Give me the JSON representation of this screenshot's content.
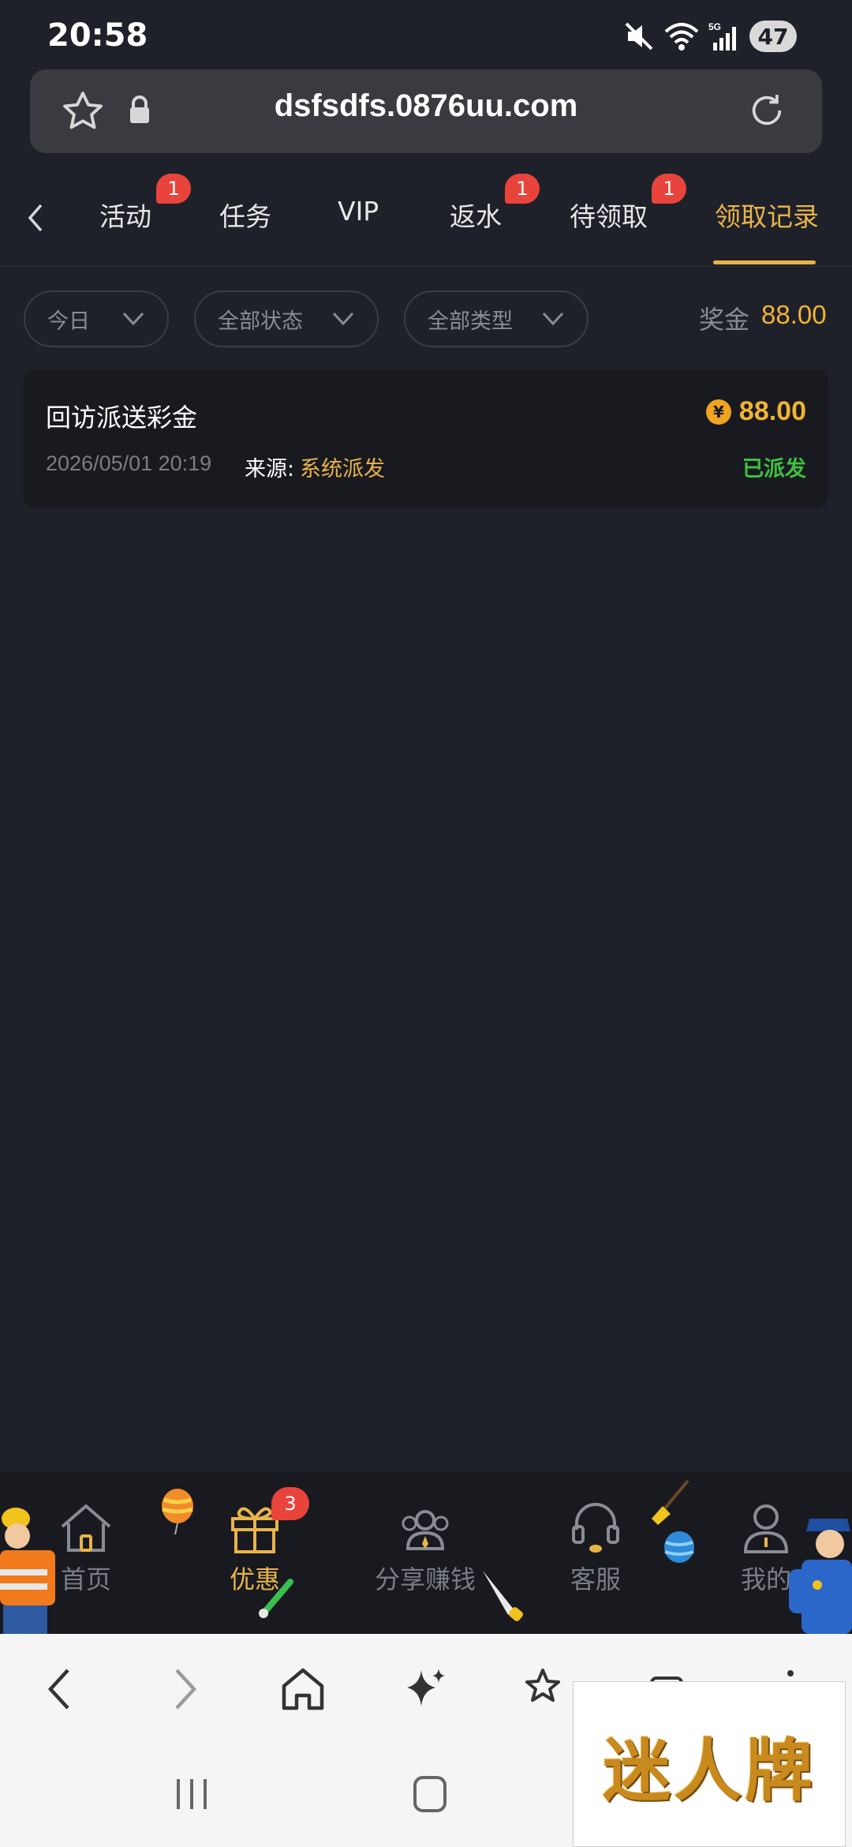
{
  "status_bar": {
    "time": "20:58",
    "battery": "47"
  },
  "address_bar": {
    "url": "dsfsdfs.0876uu.com"
  },
  "tabs": [
    {
      "label": "活动",
      "badge": "1"
    },
    {
      "label": "任务"
    },
    {
      "label": "VIP"
    },
    {
      "label": "返水",
      "badge": "1"
    },
    {
      "label": "待领取",
      "badge": "1"
    },
    {
      "label": "领取记录",
      "active": true
    }
  ],
  "filters": {
    "date": "今日",
    "status": "全部状态",
    "type": "全部类型",
    "bonus_label": "奖金",
    "bonus_value": "88.00"
  },
  "records": [
    {
      "title": "回访派送彩金",
      "amount": "88.00",
      "coin_symbol": "¥",
      "datetime": "2026/05/01 20:19",
      "source_label": "来源:",
      "source": "系统派发",
      "status": "已派发"
    }
  ],
  "bottom_nav": [
    {
      "label": "首页",
      "icon": "home-icon"
    },
    {
      "label": "优惠",
      "icon": "gift-icon",
      "badge": "3",
      "active": true
    },
    {
      "label": "分享赚钱",
      "icon": "share-users-icon"
    },
    {
      "label": "客服",
      "icon": "headset-icon"
    },
    {
      "label": "我的",
      "icon": "user-icon"
    }
  ],
  "watermark": {
    "text": "迷人牌"
  },
  "colors": {
    "background": "#1f212a",
    "accent": "#e8b44a",
    "badge": "#e8443c",
    "success": "#3fbf3f"
  }
}
